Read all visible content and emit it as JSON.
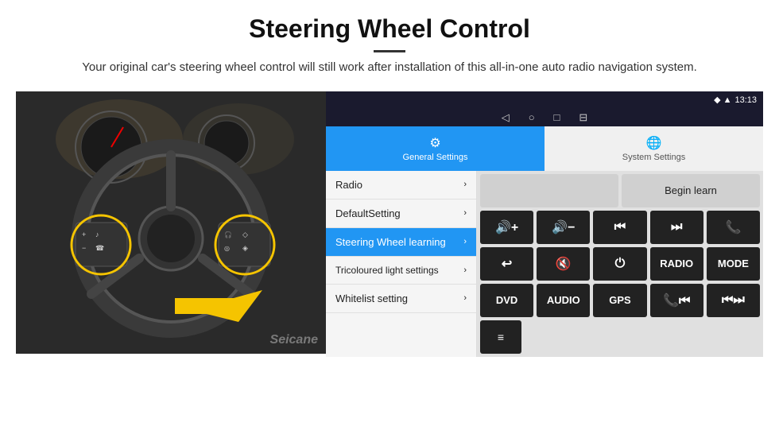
{
  "header": {
    "title": "Steering Wheel Control",
    "subtitle": "Your original car's steering wheel control will still work after installation of this all-in-one auto radio navigation system."
  },
  "status_bar": {
    "nav_icons": [
      "◁",
      "○",
      "□",
      "⊟"
    ],
    "right_icons": "♦ ▲",
    "time": "13:13"
  },
  "tabs": [
    {
      "label": "General Settings",
      "icon": "⚙",
      "active": true
    },
    {
      "label": "System Settings",
      "icon": "🌐",
      "active": false
    }
  ],
  "menu": [
    {
      "label": "Radio",
      "active": false
    },
    {
      "label": "DefaultSetting",
      "active": false
    },
    {
      "label": "Steering Wheel learning",
      "active": true
    },
    {
      "label": "Tricoloured light settings",
      "active": false
    },
    {
      "label": "Whitelist setting",
      "active": false
    }
  ],
  "controls": {
    "begin_learn": "Begin learn",
    "row1": [
      "🔊+",
      "🔊−",
      "⏮",
      "⏭",
      "📞"
    ],
    "row2": [
      "↩",
      "🔇",
      "⏻",
      "RADIO",
      "MODE"
    ],
    "row3": [
      "DVD",
      "AUDIO",
      "GPS",
      "📞⏮",
      "⏮⏭"
    ],
    "row4_icon": "≡"
  },
  "watermark": "Seicane"
}
